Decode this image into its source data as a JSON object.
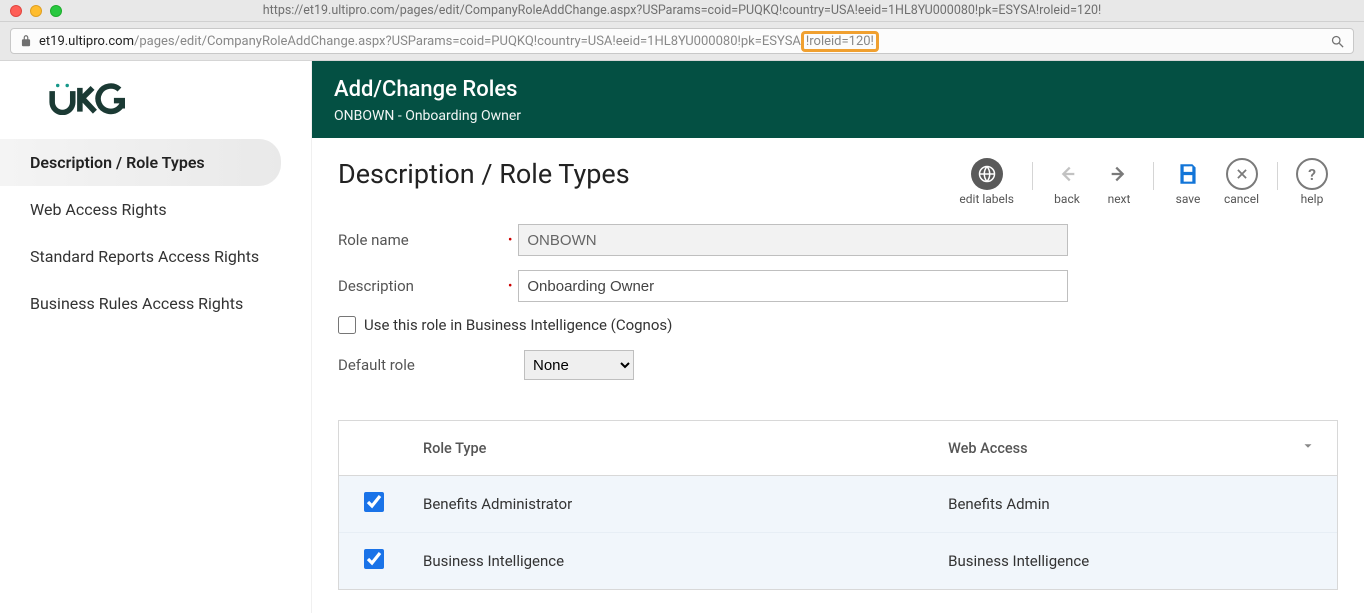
{
  "browser": {
    "title_url": "https://et19.ultipro.com/pages/edit/CompanyRoleAddChange.aspx?USParams=coid=PUQKQ!country=USA!eeid=1HL8YU000080!pk=ESYSA!roleid=120!",
    "addr_domain": "et19.ultipro.com",
    "addr_path": "/pages/edit/CompanyRoleAddChange.aspx?USParams=coid=PUQKQ!country=USA!eeid=1HL8YU000080!pk=ESYSA",
    "addr_highlight": "!roleid=120!"
  },
  "sidebar": {
    "items": [
      "Description / Role Types",
      "Web Access Rights",
      "Standard Reports Access Rights",
      "Business Rules Access Rights"
    ]
  },
  "header": {
    "title": "Add/Change Roles",
    "subtitle": "ONBOWN - Onboarding Owner"
  },
  "page": {
    "title": "Description / Role Types",
    "toolbar": {
      "edit_labels": "edit labels",
      "back": "back",
      "next": "next",
      "save": "save",
      "cancel": "cancel",
      "help": "help"
    },
    "form": {
      "role_name_label": "Role name",
      "role_name_value": "ONBOWN",
      "description_label": "Description",
      "description_value": "Onboarding Owner",
      "bi_checkbox_label": "Use this role in Business Intelligence (Cognos)",
      "default_role_label": "Default role",
      "default_role_value": "None"
    },
    "table": {
      "columns": {
        "role_type": "Role Type",
        "web_access": "Web Access"
      },
      "rows": [
        {
          "role_type": "Benefits Administrator",
          "web_access": "Benefits Admin",
          "checked": true
        },
        {
          "role_type": "Business Intelligence",
          "web_access": "Business Intelligence",
          "checked": true
        }
      ]
    }
  }
}
